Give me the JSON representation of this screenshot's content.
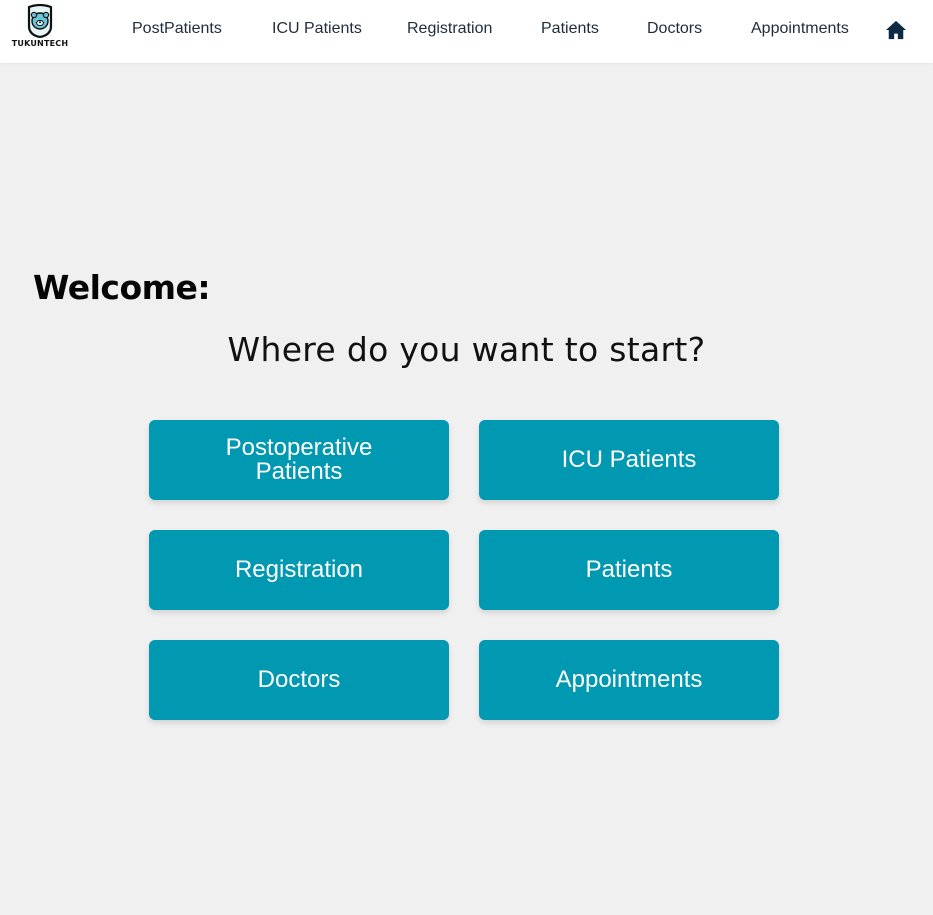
{
  "brand": {
    "name": "TUKUNTECH",
    "icon": "bear-shield-icon"
  },
  "nav": {
    "items": [
      {
        "label": "PostPatients"
      },
      {
        "label": "ICU Patients"
      },
      {
        "label": "Registration"
      },
      {
        "label": "Patients"
      },
      {
        "label": "Doctors"
      },
      {
        "label": "Appointments"
      }
    ],
    "home_icon": "home-icon"
  },
  "main": {
    "welcome": "Welcome:",
    "prompt": "Where do you want to start?",
    "cards": [
      {
        "label": "Postoperative Patients"
      },
      {
        "label": "ICU Patients"
      },
      {
        "label": "Registration"
      },
      {
        "label": "Patients"
      },
      {
        "label": "Doctors"
      },
      {
        "label": "Appointments"
      }
    ]
  },
  "colors": {
    "accent": "#0198b1",
    "background": "#f0f0f0",
    "nav_text": "#1f2d3a",
    "home_icon": "#0d2a45"
  }
}
